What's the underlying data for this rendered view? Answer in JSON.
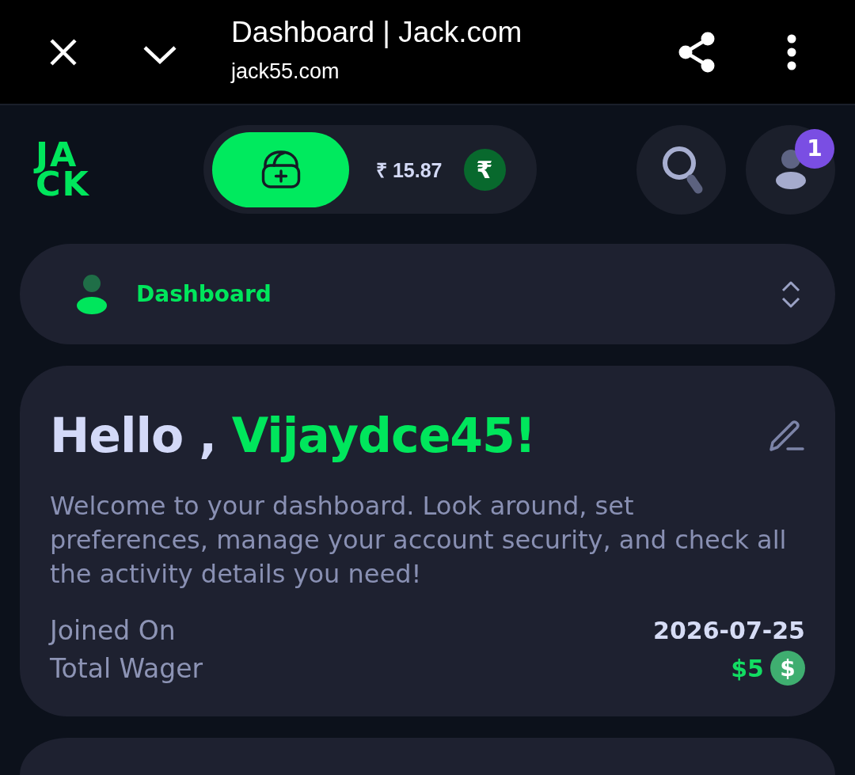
{
  "browser_bar": {
    "title": "Dashboard | Jack.com",
    "url": "jack55.com"
  },
  "header": {
    "logo": "JACK",
    "wallet": {
      "balance": "₹ 15.87",
      "currency_icon": "₹"
    },
    "notifications": {
      "count": "1"
    }
  },
  "dashboard_menu": {
    "label": "Dashboard"
  },
  "profile_card": {
    "greeting": "Hello ,",
    "username": "Vijaydce45!",
    "description": "Welcome to your dashboard. Look around, set preferences, manage your account security, and check all the activity details you need!",
    "stats": [
      {
        "kind": "text",
        "label": "Joined On",
        "value": "2026-07-25"
      },
      {
        "kind": "money",
        "label": "Total Wager",
        "value": "$5",
        "icon": "$"
      }
    ]
  }
}
